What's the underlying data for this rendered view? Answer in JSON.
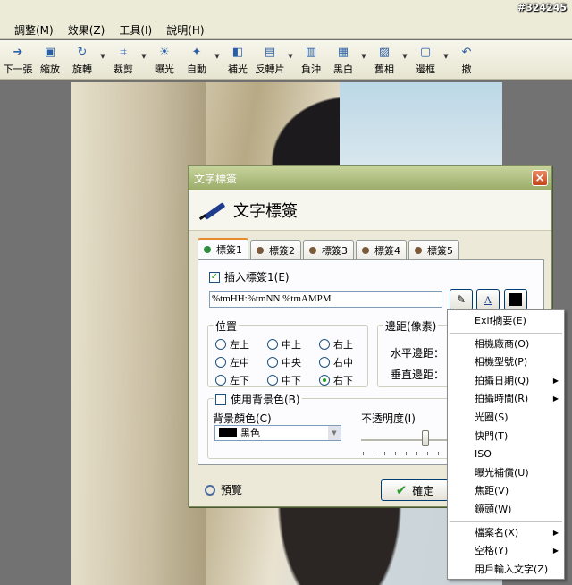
{
  "watermark": "#324245",
  "menu": [
    "調整(M)",
    "效果(Z)",
    "工具(I)",
    "說明(H)"
  ],
  "toolbar": [
    {
      "label": "下一張",
      "icon": "next-arrow-icon",
      "drop": false
    },
    {
      "label": "縮放",
      "icon": "resize-icon",
      "drop": false
    },
    {
      "label": "旋轉",
      "icon": "rotate-icon",
      "drop": true
    },
    {
      "label": "裁剪",
      "icon": "crop-icon",
      "drop": true
    },
    {
      "label": "曝光",
      "icon": "exposure-icon",
      "drop": false
    },
    {
      "label": "自動",
      "icon": "auto-fix-icon",
      "drop": true
    },
    {
      "label": "補光",
      "icon": "fill-light-icon",
      "drop": false
    },
    {
      "label": "反轉片",
      "icon": "reversal-film-icon",
      "drop": true
    },
    {
      "label": "負沖",
      "icon": "negative-process-icon",
      "drop": false
    },
    {
      "label": "黑白",
      "icon": "black-white-icon",
      "drop": true
    },
    {
      "label": "舊相",
      "icon": "old-photo-icon",
      "drop": true
    },
    {
      "label": "邊框",
      "icon": "frame-icon",
      "drop": true
    },
    {
      "label": "撤",
      "icon": "undo-icon",
      "drop": false
    }
  ],
  "dialog": {
    "title": "文字標簽",
    "heading": "文字標簽",
    "close_label": "×",
    "tabs": [
      "標簽1",
      "標簽2",
      "標簽3",
      "標簽4",
      "標簽5"
    ],
    "insert_checkbox": "插入標簽1(E)",
    "format_value": "%tmHH:%tmNN %tmAMPM",
    "font_button_text": "A",
    "position": {
      "label": "位置",
      "options": [
        "左上",
        "中上",
        "右上",
        "左中",
        "中央",
        "右中",
        "左下",
        "中下",
        "右下"
      ],
      "selected": "右下"
    },
    "margin": {
      "label": "邊距(像素)",
      "horizontal": "水平邊距：",
      "vertical": "垂直邊距："
    },
    "use_bg_checkbox": "使用背景色(B)",
    "bg_color_label": "背景顏色(C)",
    "bg_color_value": "黑色",
    "opacity_label": "不透明度(I)",
    "opacity_value": 0.72,
    "preview_label": "預覽",
    "ok_label": "確定"
  },
  "context_menu": [
    {
      "label": "Exif摘要(E)",
      "submenu": false
    },
    {
      "sep": true
    },
    {
      "label": "相機廠商(O)",
      "submenu": false
    },
    {
      "label": "相機型號(P)",
      "submenu": false
    },
    {
      "label": "拍攝日期(Q)",
      "submenu": true
    },
    {
      "label": "拍攝時間(R)",
      "submenu": true
    },
    {
      "label": "光圈(S)",
      "submenu": false
    },
    {
      "label": "快門(T)",
      "submenu": false
    },
    {
      "label": "ISO",
      "submenu": false
    },
    {
      "label": "曝光補償(U)",
      "submenu": false
    },
    {
      "label": "焦距(V)",
      "submenu": false
    },
    {
      "label": "鏡頭(W)",
      "submenu": false
    },
    {
      "sep": true
    },
    {
      "label": "檔案名(X)",
      "submenu": true
    },
    {
      "label": "空格(Y)",
      "submenu": true
    },
    {
      "label": "用戶輸入文字(Z)",
      "submenu": false
    }
  ]
}
